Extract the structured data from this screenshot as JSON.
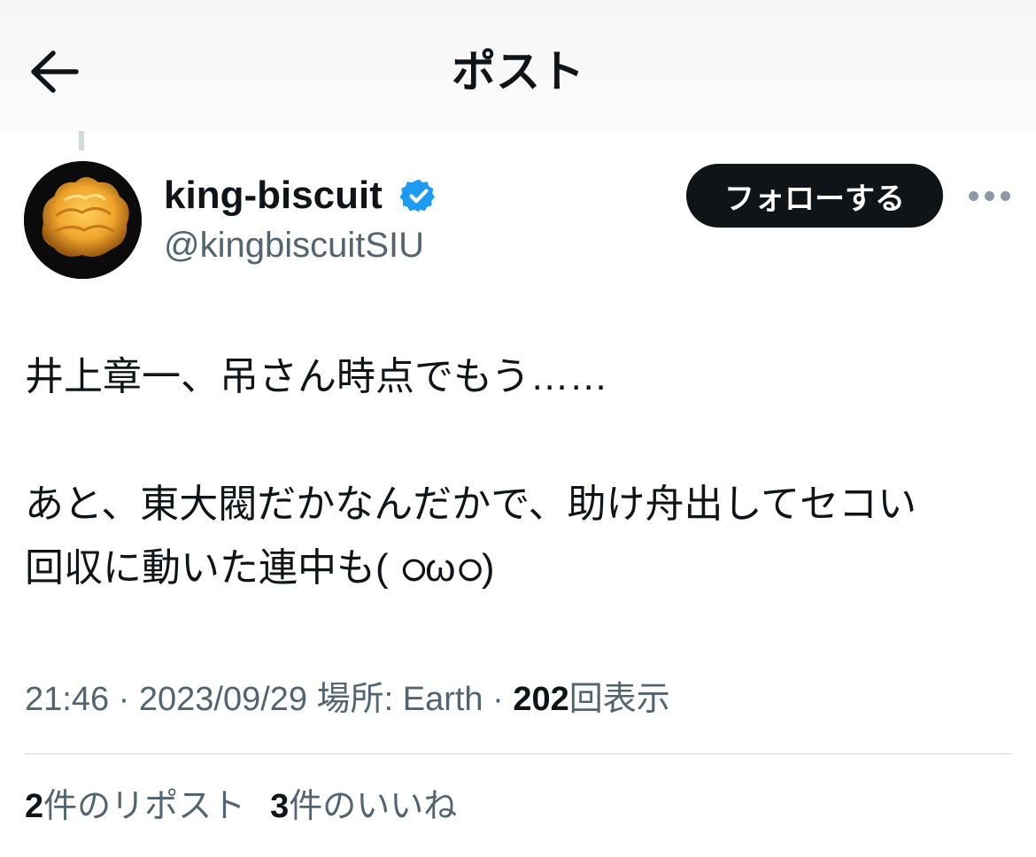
{
  "header": {
    "title": "ポスト",
    "back_icon": "arrow-left-icon"
  },
  "author": {
    "display_name": "king-biscuit",
    "handle": "@kingbiscuitSIU",
    "verified_icon": "verified-badge-icon",
    "verified_color": "#1d9bf0"
  },
  "actions": {
    "follow_label": "フォローする",
    "more_icon": "ellipsis-icon"
  },
  "tweet": {
    "lines": [
      "井上章一、吊さん時点でもう……",
      "あと、東大閥だかなんだかで、助け舟出してセコい",
      "回収に動いた連中も( ഠωഠ)"
    ]
  },
  "meta": {
    "time": "21:46",
    "sep1": " · ",
    "date": "2023/09/29",
    "location": " 場所: Earth",
    "sep2": " · ",
    "views_count": "202",
    "views_label": "回表示"
  },
  "stats": {
    "reposts_count": "2",
    "reposts_label": "件のリポスト",
    "likes_count": "3",
    "likes_label": "件のいいね"
  },
  "colors": {
    "text": "#0f1419",
    "secondary": "#536471",
    "accent": "#1d9bf0"
  }
}
